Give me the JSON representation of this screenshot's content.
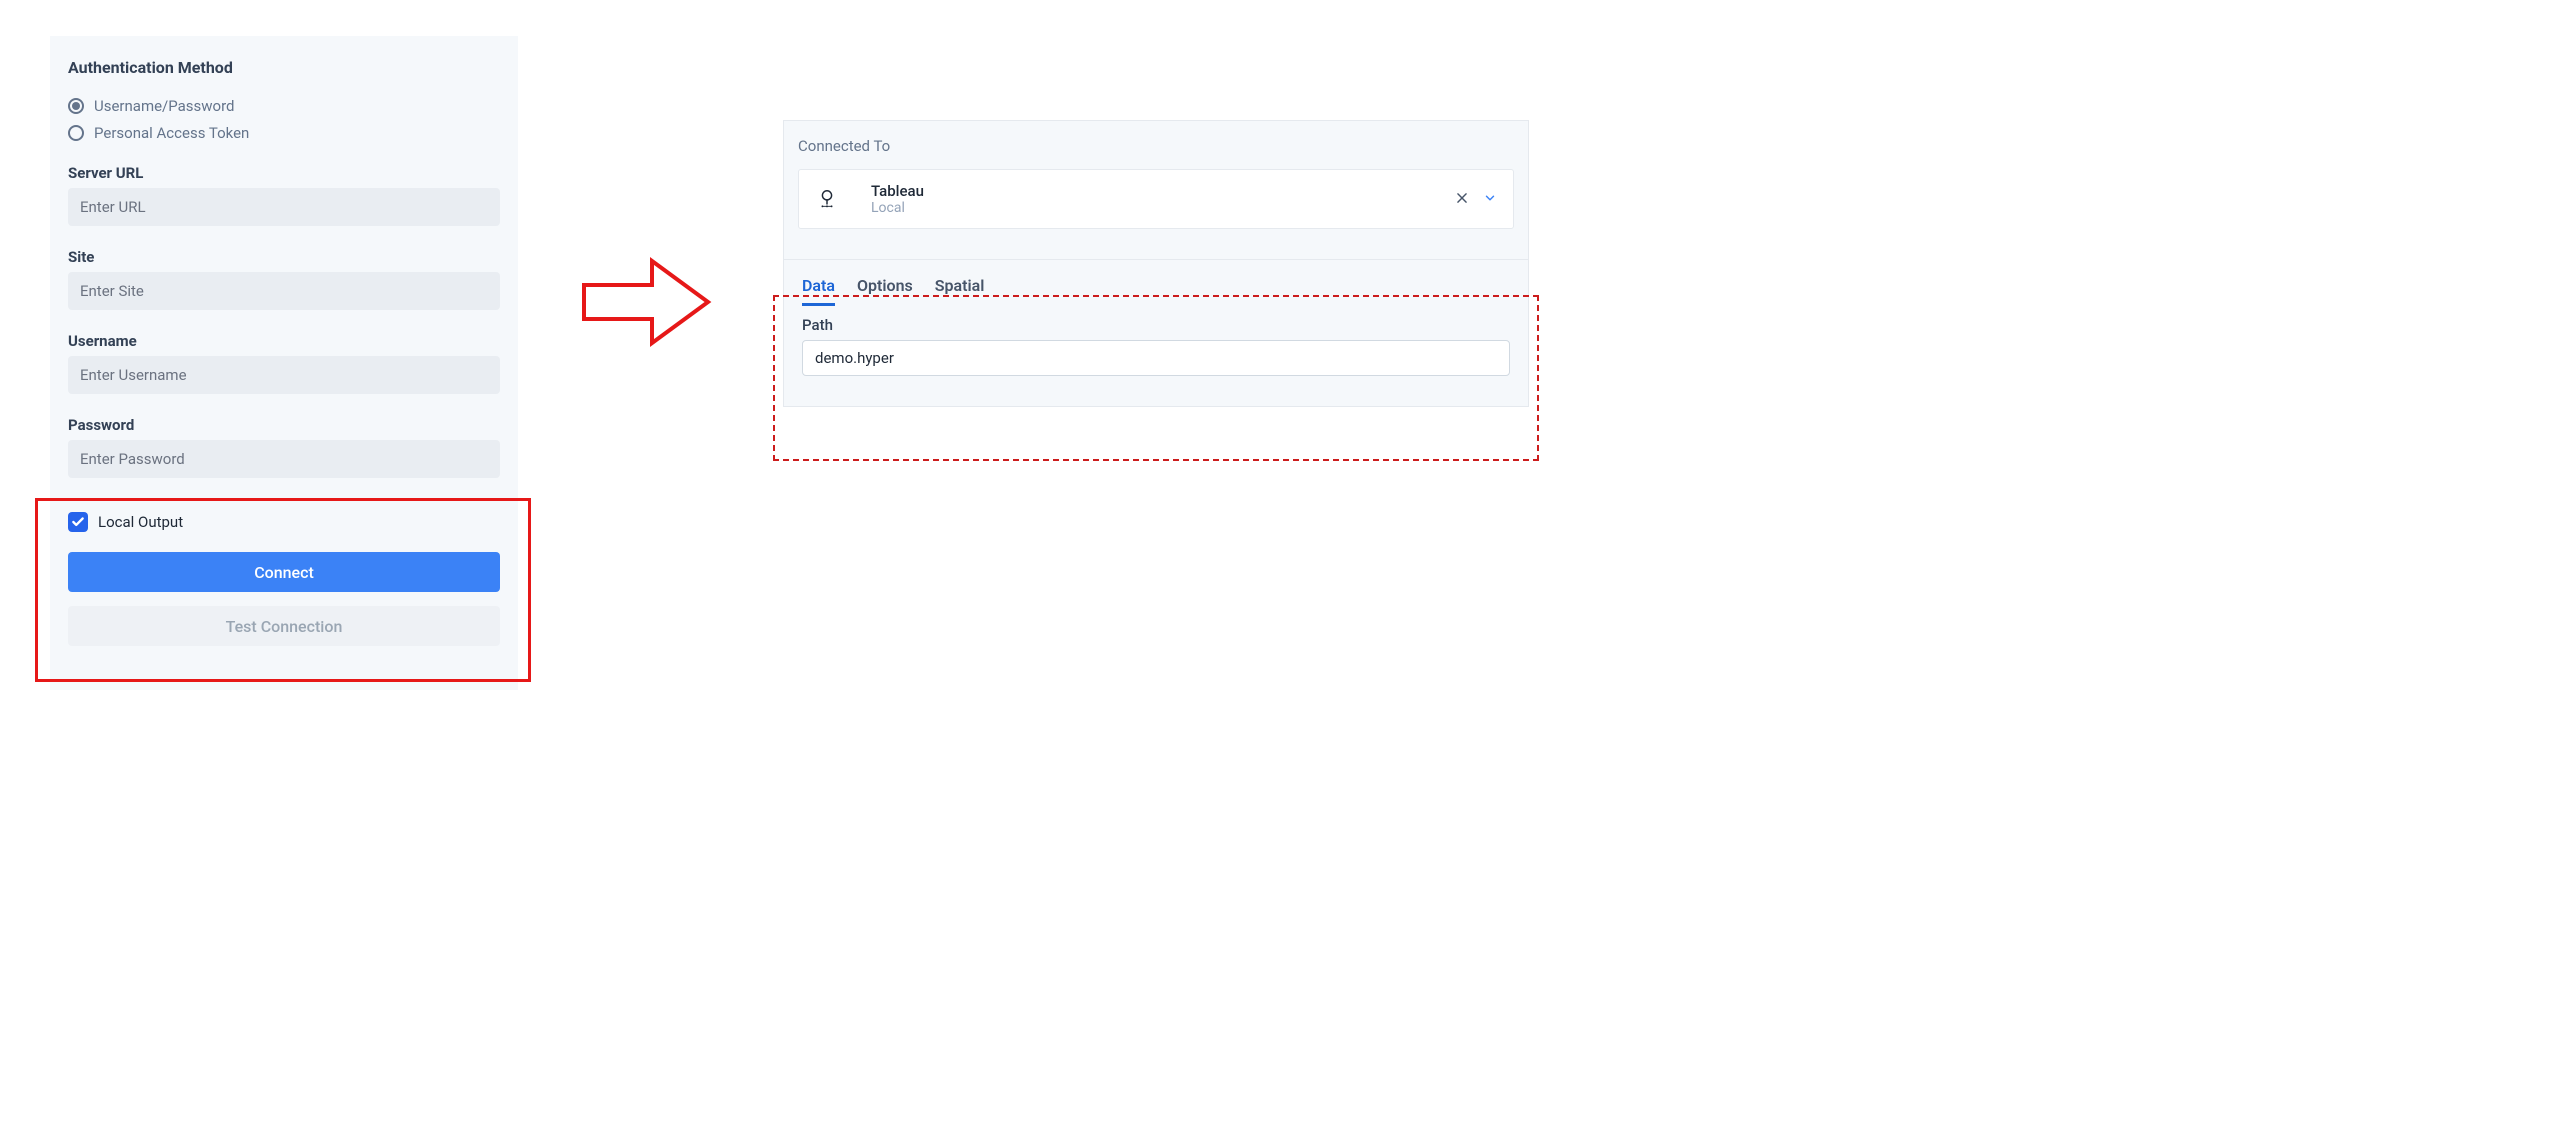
{
  "left": {
    "auth_method_title": "Authentication Method",
    "radio_username_password": "Username/Password",
    "radio_pat": "Personal Access Token",
    "server_url_label": "Server URL",
    "server_url_placeholder": "Enter URL",
    "site_label": "Site",
    "site_placeholder": "Enter Site",
    "username_label": "Username",
    "username_placeholder": "Enter Username",
    "password_label": "Password",
    "password_placeholder": "Enter Password",
    "local_output_label": "Local Output",
    "connect_label": "Connect",
    "test_connection_label": "Test Connection"
  },
  "right": {
    "connected_to": "Connected To",
    "connection_title": "Tableau",
    "connection_sub": "Local",
    "tabs": {
      "data": "Data",
      "options": "Options",
      "spatial": "Spatial"
    },
    "path_label": "Path",
    "path_value": "demo.hyper"
  }
}
